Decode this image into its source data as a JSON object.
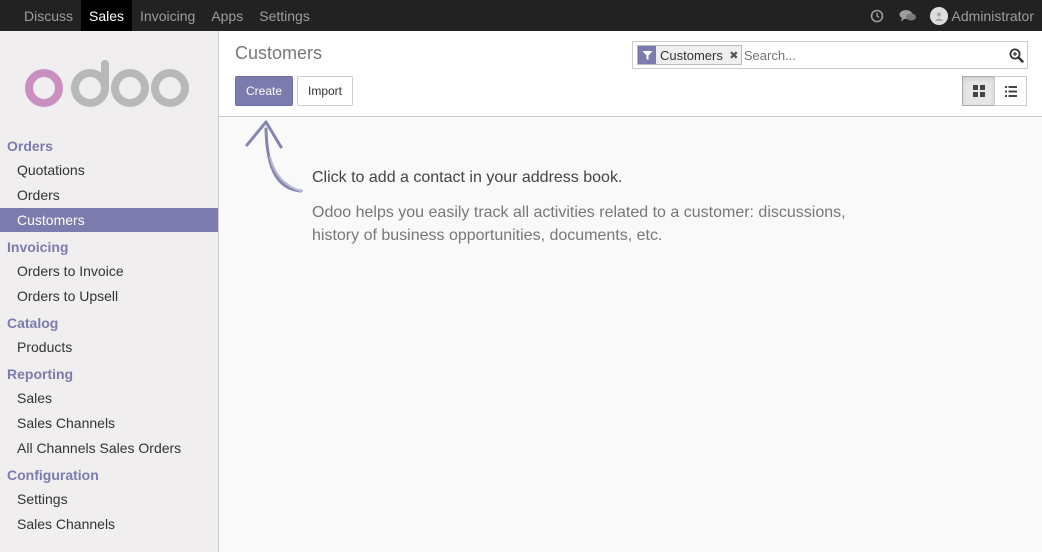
{
  "topbar": {
    "menu": [
      {
        "label": "Discuss"
      },
      {
        "label": "Sales"
      },
      {
        "label": "Invoicing"
      },
      {
        "label": "Apps"
      },
      {
        "label": "Settings"
      }
    ],
    "active_menu": "Sales",
    "icons": [
      "clock-icon",
      "chat-icon"
    ],
    "user": "Administrator"
  },
  "sidebar": {
    "logo_text": "odoo",
    "logo_colors": {
      "o1": "#c88fbf",
      "rest": "#b8b8b8"
    },
    "sections": [
      {
        "title": "Orders",
        "items": [
          "Quotations",
          "Orders",
          "Customers"
        ]
      },
      {
        "title": "Invoicing",
        "items": [
          "Orders to Invoice",
          "Orders to Upsell"
        ]
      },
      {
        "title": "Catalog",
        "items": [
          "Products"
        ]
      },
      {
        "title": "Reporting",
        "items": [
          "Sales",
          "Sales Channels",
          "All Channels Sales Orders"
        ]
      },
      {
        "title": "Configuration",
        "items": [
          "Settings",
          "Sales Channels"
        ]
      }
    ],
    "active_item": "Customers"
  },
  "control": {
    "breadcrumb": "Customers",
    "create_label": "Create",
    "import_label": "Import",
    "search": {
      "facet_value": "Customers",
      "facet_remove": "✖",
      "placeholder": "Search...",
      "value": ""
    },
    "views": [
      "kanban",
      "list"
    ],
    "active_view": "kanban"
  },
  "content": {
    "help_title": "Click to add a contact in your address book.",
    "help_text": "Odoo helps you easily track all activities related to a customer: discussions, history of business opportunities, documents, etc."
  },
  "colors": {
    "accent": "#7c7bad",
    "topbar": "#222222",
    "topbar_active": "#000000"
  }
}
